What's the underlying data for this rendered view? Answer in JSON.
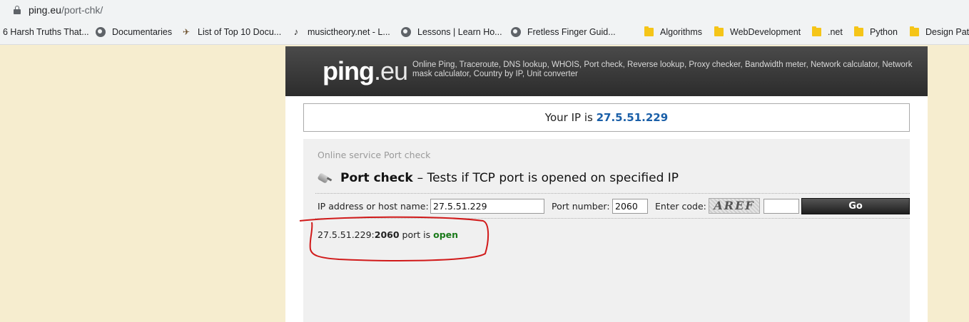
{
  "browser": {
    "url_host": "ping.eu",
    "url_path": "/port-chk/",
    "bookmarks": [
      {
        "label": "6 Harsh Truths That...",
        "icon": "none"
      },
      {
        "label": "Documentaries",
        "icon": "globe-icon"
      },
      {
        "label": "List of Top 10 Docu...",
        "icon": "hummingbird-icon"
      },
      {
        "label": "musictheory.net - L...",
        "icon": "musictheory-icon"
      },
      {
        "label": "Lessons | Learn Ho...",
        "icon": "globe-icon"
      },
      {
        "label": "Fretless Finger Guid...",
        "icon": "globe-icon"
      },
      {
        "label": "Algorithms",
        "icon": "folder-icon"
      },
      {
        "label": "WebDevelopment",
        "icon": "folder-icon"
      },
      {
        "label": ".net",
        "icon": "folder-icon"
      },
      {
        "label": "Python",
        "icon": "folder-icon"
      },
      {
        "label": "Design Patt",
        "icon": "folder-icon"
      }
    ]
  },
  "header": {
    "logo_main": "ping",
    "logo_suffix": ".eu",
    "tagline": "Online Ping, Traceroute, DNS lookup, WHOIS, Port check, Reverse lookup, Proxy checker, Bandwidth meter, Network calculator, Network mask calculator, Country by IP, Unit converter"
  },
  "ip_banner": {
    "prefix": "Your IP is",
    "ip": "27.5.51.229"
  },
  "service": {
    "label": "Online service Port check",
    "title": "Port check",
    "description": "– Tests if TCP port is opened on specified IP"
  },
  "form": {
    "host_label": "IP address or host name:",
    "host_value": "27.5.51.229",
    "port_label": "Port number:",
    "port_value": "2060",
    "code_label": "Enter code:",
    "captcha_text": "AREF",
    "code_value": "",
    "go_label": "Go"
  },
  "result": {
    "host": "27.5.51.229:",
    "port": "2060",
    "middle": "port is",
    "status": "open"
  },
  "colors": {
    "page_bg": "#f6edcf",
    "header_bg": "#333333",
    "ip_color": "#1a5fa8",
    "open_color": "#1a7a1a",
    "annotation": "#d11a1a"
  }
}
